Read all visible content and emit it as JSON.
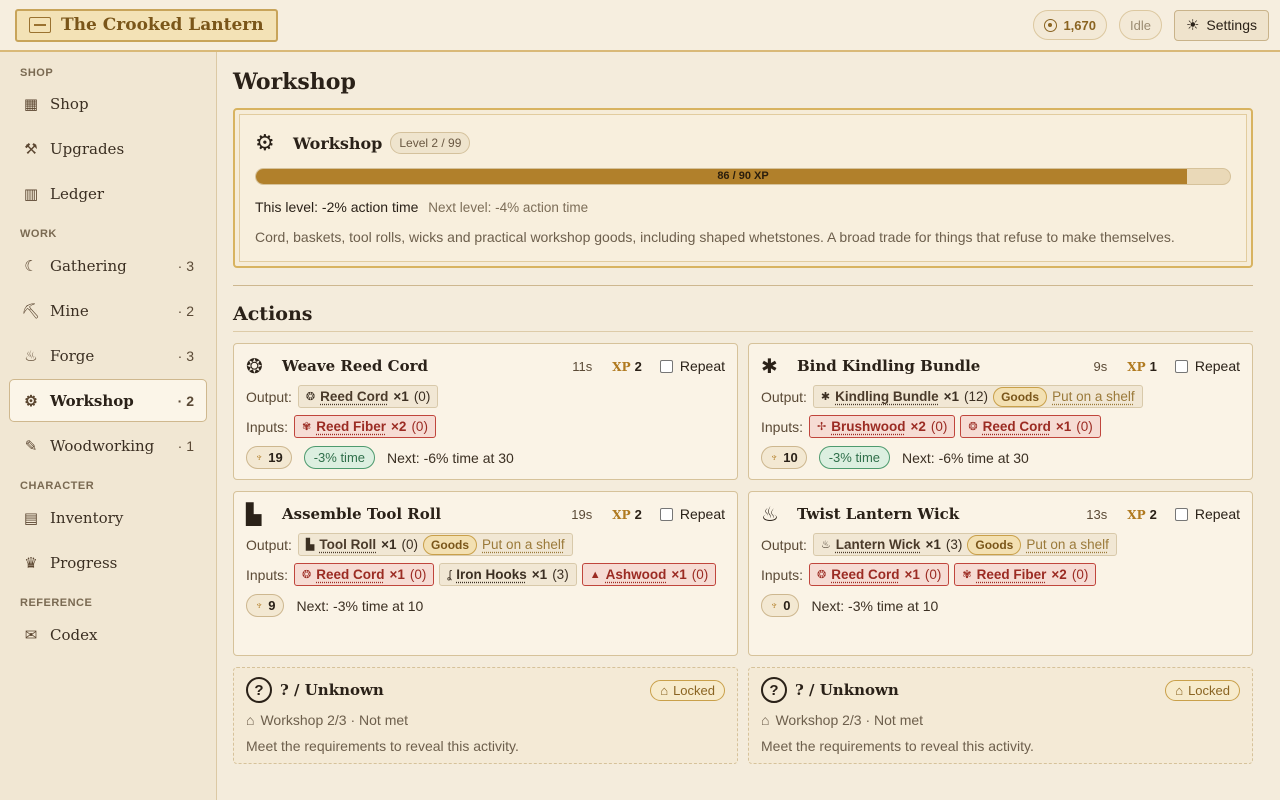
{
  "app": {
    "title": "The Crooked Lantern"
  },
  "top": {
    "coins": "1,670",
    "status": "Idle",
    "settings_label": "Settings"
  },
  "sidebar": {
    "shop_head": "SHOP",
    "work_head": "WORK",
    "character_head": "CHARACTER",
    "reference_head": "REFERENCE",
    "items": [
      {
        "label": "Shop",
        "icon": "shop-icon"
      },
      {
        "label": "Upgrades",
        "icon": "hammer-icon"
      },
      {
        "label": "Ledger",
        "icon": "ledger-icon"
      },
      {
        "label": "Gathering",
        "icon": "sickle-icon",
        "count": "· 3"
      },
      {
        "label": "Mine",
        "icon": "pickaxe-icon",
        "count": "· 2"
      },
      {
        "label": "Forge",
        "icon": "anvil-icon",
        "count": "· 3"
      },
      {
        "label": "Workshop",
        "icon": "workshop-icon",
        "count": "· 2"
      },
      {
        "label": "Woodworking",
        "icon": "chisel-icon",
        "count": "· 1"
      },
      {
        "label": "Inventory",
        "icon": "shelves-icon"
      },
      {
        "label": "Progress",
        "icon": "medal-icon"
      },
      {
        "label": "Codex",
        "icon": "scroll-icon"
      }
    ]
  },
  "main": {
    "page_title": "Workshop",
    "skill": {
      "name": "Workshop",
      "level": "Level 2 / 99",
      "xp_text": "86 / 90 XP",
      "xp_fraction": 0.9556,
      "this_level": "This level: -2% action time",
      "next_level": "Next level: -4% action time",
      "description": "Cord, baskets, tool rolls, wicks and practical workshop goods, including shaped whetstones. A broad trade for things that refuse to make themselves."
    },
    "actions_title": "Actions",
    "output_label": "Output:",
    "inputs_label": "Inputs:",
    "repeat_label": "Repeat",
    "xp_label": "XP",
    "goods_label": "Goods",
    "shelf_label": "Put on a shelf",
    "actions": [
      {
        "name": "Weave Reed Cord",
        "time": "11s",
        "xp": "2",
        "output": {
          "name": "Reed Cord",
          "qty": "×1",
          "own": "(0)"
        },
        "inputs": [
          {
            "name": "Reed Fiber",
            "qty": "×2",
            "own": "(0)"
          }
        ],
        "trophy": "19",
        "speed": "-3% time",
        "next": "Next: -6% time at 30"
      },
      {
        "name": "Bind Kindling Bundle",
        "time": "9s",
        "xp": "1",
        "output": {
          "name": "Kindling Bundle",
          "qty": "×1",
          "own": "(12)"
        },
        "inputs": [
          {
            "name": "Brushwood",
            "qty": "×2",
            "own": "(0)"
          },
          {
            "name": "Reed Cord",
            "qty": "×1",
            "own": "(0)"
          }
        ],
        "trophy": "10",
        "speed": "-3% time",
        "next": "Next: -6% time at 30"
      },
      {
        "name": "Assemble Tool Roll",
        "time": "19s",
        "xp": "2",
        "output": {
          "name": "Tool Roll",
          "qty": "×1",
          "own": "(0)"
        },
        "inputs": [
          {
            "name": "Reed Cord",
            "qty": "×1",
            "own": "(0)"
          },
          {
            "name": "Iron Hooks",
            "qty": "×1",
            "own": "(3)"
          },
          {
            "name": "Ashwood",
            "qty": "×1",
            "own": "(0)"
          }
        ],
        "trophy": "9",
        "next": "Next: -3% time at 10"
      },
      {
        "name": "Twist Lantern Wick",
        "time": "13s",
        "xp": "2",
        "output": {
          "name": "Lantern Wick",
          "qty": "×1",
          "own": "(3)"
        },
        "inputs": [
          {
            "name": "Reed Cord",
            "qty": "×1",
            "own": "(0)"
          },
          {
            "name": "Reed Fiber",
            "qty": "×2",
            "own": "(0)"
          }
        ],
        "trophy": "0",
        "next": "Next: -3% time at 10"
      }
    ],
    "locked": {
      "name": "? / Unknown",
      "badge": "Locked",
      "req": "Workshop 2/3 · Not met",
      "note": "Meet the requirements to reveal this activity."
    }
  }
}
